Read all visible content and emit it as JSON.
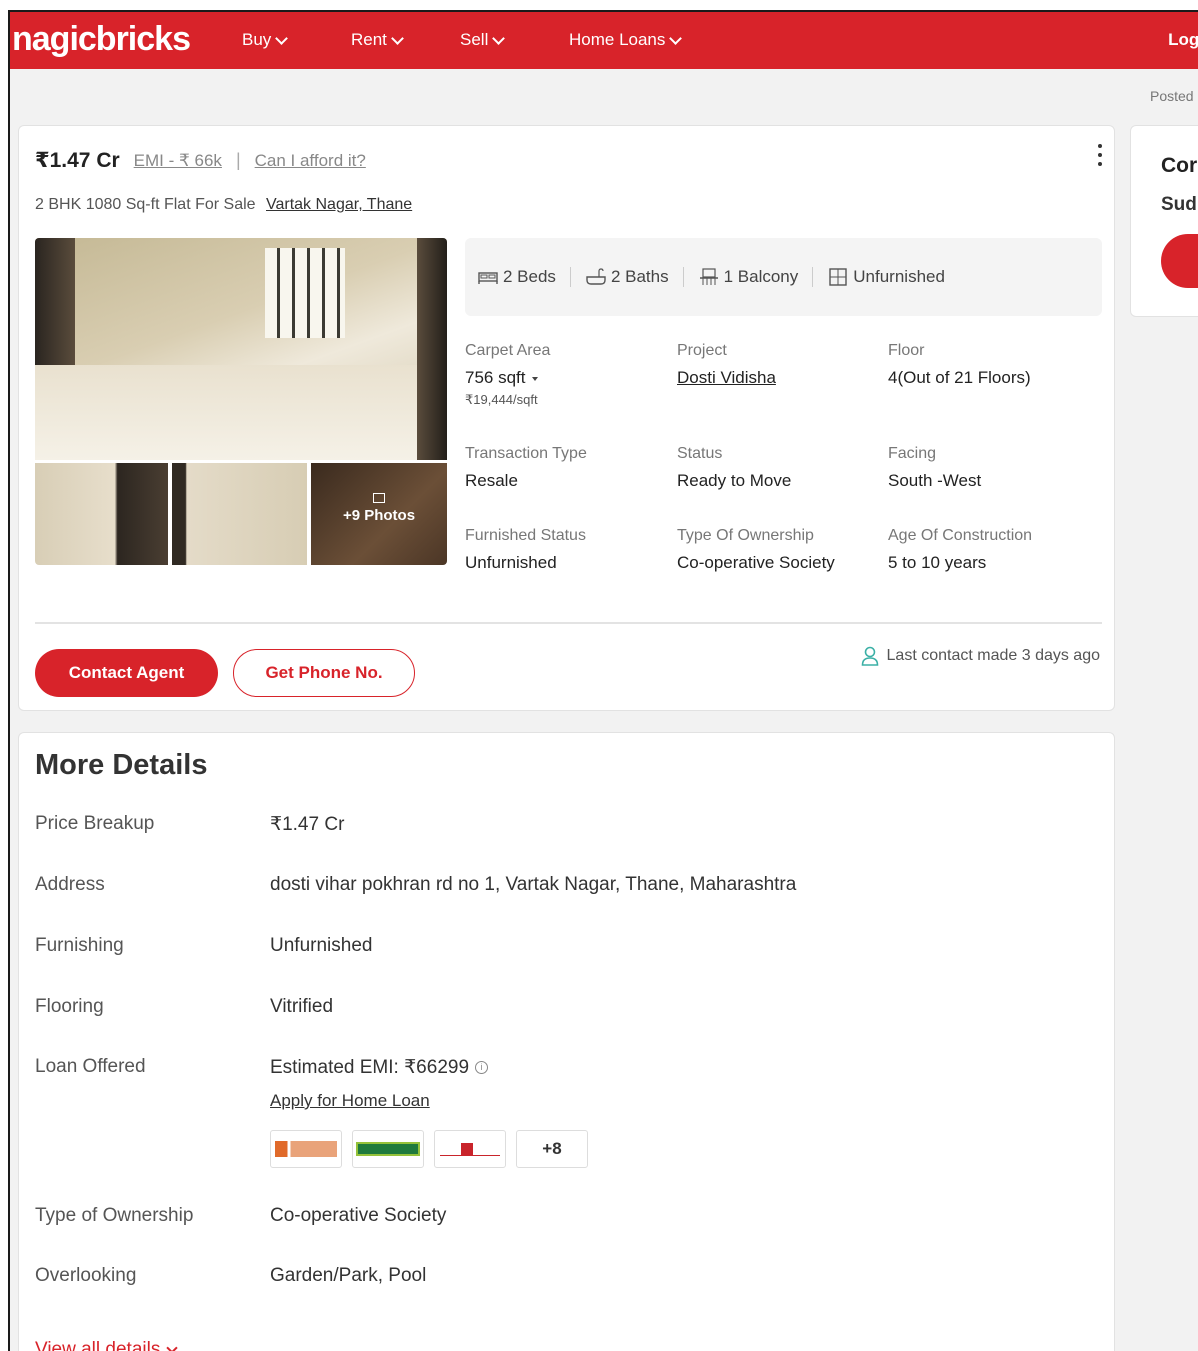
{
  "header": {
    "logo": "nagicbricks",
    "nav": [
      "Buy",
      "Rent",
      "Sell",
      "Home Loans"
    ],
    "login": "Logi",
    "posted": "Posted"
  },
  "listing": {
    "price": "₹1.47 Cr",
    "emi_link": "EMI - ₹ 66k",
    "separator": "|",
    "afford_link": "Can I afford it?",
    "subtitle": "2 BHK 1080 Sq-ft Flat For Sale",
    "locality": "Vartak Nagar, Thane",
    "more_photos": "+9 Photos",
    "summary": [
      {
        "icon": "bed-icon",
        "label": "2 Beds"
      },
      {
        "icon": "bath-icon",
        "label": "2 Baths"
      },
      {
        "icon": "balcony-icon",
        "label": "1 Balcony"
      },
      {
        "icon": "furnishing-icon",
        "label": "Unfurnished"
      }
    ],
    "info": [
      {
        "label": "Carpet Area",
        "value": "756 sqft",
        "sub": "₹19,444/sqft"
      },
      {
        "label": "Project",
        "value": "Dosti Vidisha"
      },
      {
        "label": "Floor",
        "value": "4(Out of 21 Floors)"
      },
      {
        "label": "Transaction Type",
        "value": "Resale"
      },
      {
        "label": "Status",
        "value": "Ready to Move"
      },
      {
        "label": "Facing",
        "value": "South -West"
      },
      {
        "label": "Furnished Status",
        "value": "Unfurnished"
      },
      {
        "label": "Type Of Ownership",
        "value": "Co-operative Society"
      },
      {
        "label": "Age Of Construction",
        "value": "5 to 10 years"
      }
    ],
    "contact_button": "Contact Agent",
    "phone_button": "Get Phone No.",
    "last_contact": "Last contact made 3 days ago"
  },
  "side": {
    "title": "Cor",
    "subtitle": "Sud"
  },
  "details": {
    "title": "More Details",
    "rows": [
      {
        "key": "Price Breakup",
        "value": "₹1.47 Cr"
      },
      {
        "key": "Address",
        "value": "dosti vihar pokhran rd no 1, Vartak Nagar, Thane, Maharashtra"
      },
      {
        "key": "Furnishing",
        "value": "Unfurnished"
      },
      {
        "key": "Flooring",
        "value": "Vitrified"
      },
      {
        "key": "Loan Offered",
        "value": "Estimated EMI: ₹66299"
      },
      {
        "key": "Type of Ownership",
        "value": "Co-operative Society"
      },
      {
        "key": "Overlooking",
        "value": "Garden/Park, Pool"
      }
    ],
    "apply_link": "Apply for Home Loan",
    "more_banks": "+8",
    "view_all": "View all details"
  },
  "colors": {
    "brand": "#d8232a",
    "background": "#f2f2f2"
  }
}
